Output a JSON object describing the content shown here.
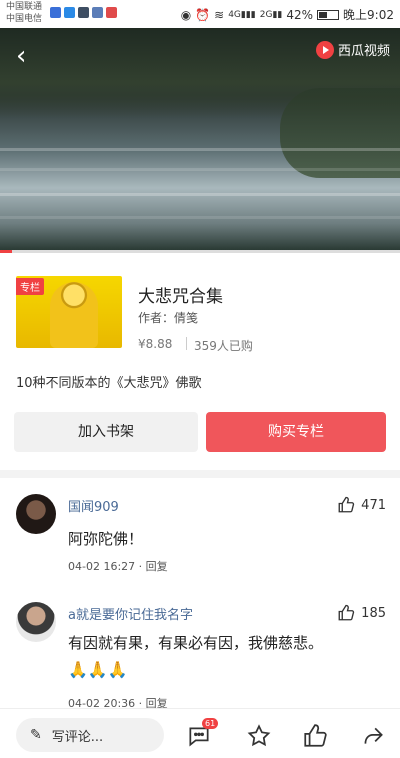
{
  "status_bar": {
    "carrier_1": "中国联通",
    "carrier_2": "中国电信",
    "battery_percent": "42%",
    "time": "晚上9:02",
    "network_1": "4G",
    "network_2": "2G"
  },
  "video": {
    "brand": "西瓜视频",
    "playback_progress": 0.03
  },
  "product": {
    "tag": "专栏",
    "title": "大悲咒合集",
    "author": "作者：倩笺",
    "price": "¥8.88",
    "sold": "359人已购",
    "description": "10种不同版本的《大悲咒》佛歌"
  },
  "actions": {
    "add_to_shelf": "加入书架",
    "buy": "购买专栏"
  },
  "comments": [
    {
      "user": "国闻909",
      "likes": "471",
      "text": "阿弥陀佛！",
      "time": "04-02 16:27",
      "reply": "· 回复"
    },
    {
      "user": "a就是要你记住我名字",
      "likes": "185",
      "text": "有因就有果，有果必有因，我佛慈悲。",
      "emoji": "🙏🙏🙏",
      "time": "04-02 20:36",
      "reply": "· 回复"
    }
  ],
  "bottom_bar": {
    "write_placeholder": "写评论...",
    "comment_count": "61"
  },
  "colors": {
    "accent": "#f04142",
    "buy_button": "#f0565b",
    "username": "#4a6a96"
  }
}
